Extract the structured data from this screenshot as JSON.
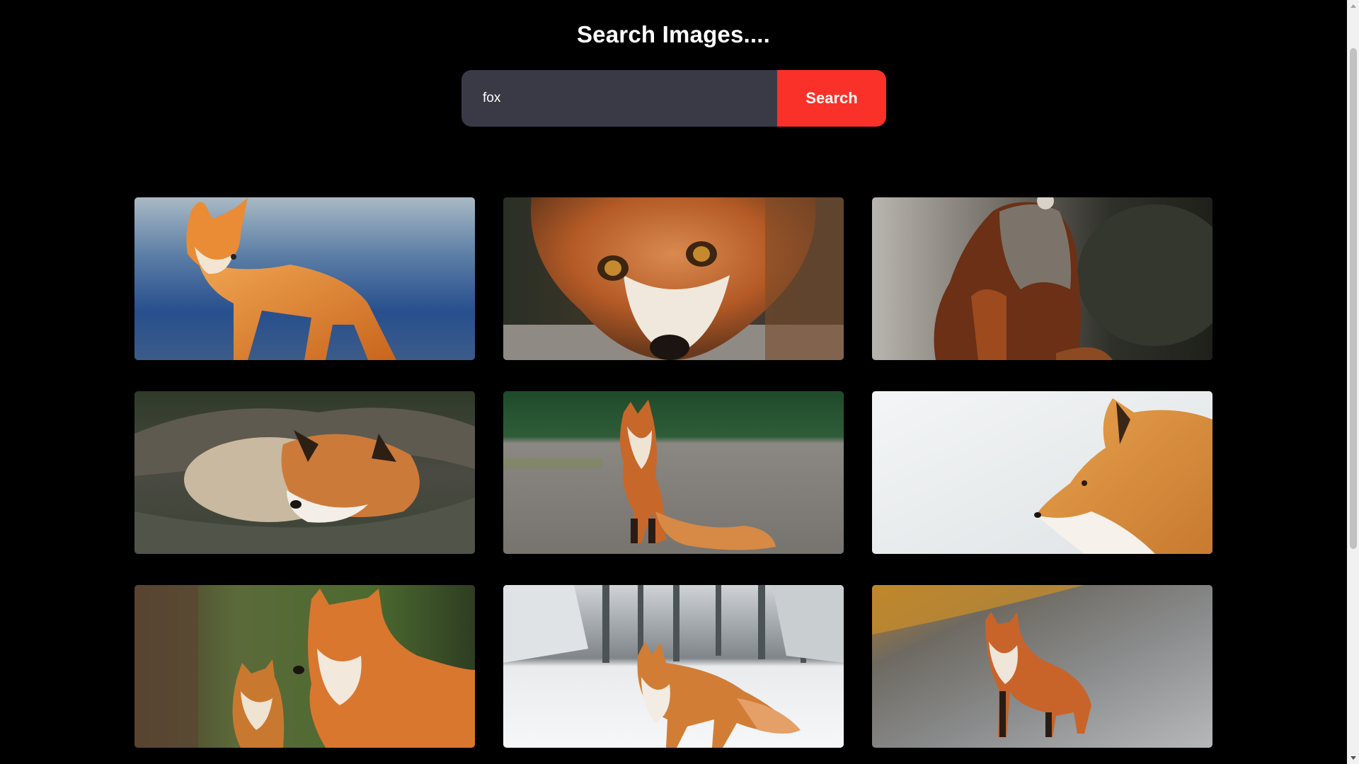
{
  "header": {
    "title": "Search Images...."
  },
  "search": {
    "value": "fox",
    "button_label": "Search"
  },
  "results": [
    {
      "name": "fox-standing-blue-background"
    },
    {
      "name": "fox-face-closeup"
    },
    {
      "name": "fox-sitting-dark-rocks"
    },
    {
      "name": "fox-sleeping-on-logs"
    },
    {
      "name": "fox-sitting-on-gravel"
    },
    {
      "name": "fox-profile-white-background"
    },
    {
      "name": "fox-mother-and-cub"
    },
    {
      "name": "fox-in-snowy-forest"
    },
    {
      "name": "fox-on-wet-road"
    }
  ],
  "colors": {
    "background": "#000000",
    "input_background": "#3a3a47",
    "accent": "#fa3128"
  }
}
